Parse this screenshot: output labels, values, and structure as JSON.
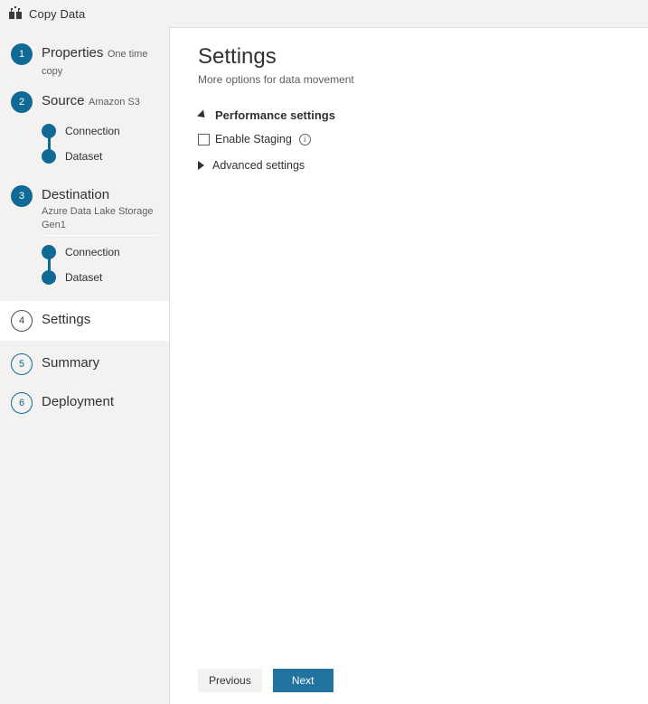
{
  "header": {
    "title": "Copy Data",
    "icon": "copy-data-icon"
  },
  "sidebar": {
    "steps": [
      {
        "number": "1",
        "label": "Properties",
        "sublabel": "One time copy",
        "state": "completed",
        "substeps": []
      },
      {
        "number": "2",
        "label": "Source",
        "sublabel": "Amazon S3",
        "state": "completed",
        "substeps": [
          {
            "label": "Connection"
          },
          {
            "label": "Dataset"
          }
        ]
      },
      {
        "number": "3",
        "label": "Destination",
        "sublabel": "Azure Data Lake Storage Gen1",
        "state": "completed",
        "substeps": [
          {
            "label": "Connection"
          },
          {
            "label": "Dataset"
          }
        ]
      },
      {
        "number": "4",
        "label": "Settings",
        "sublabel": "",
        "state": "active",
        "substeps": []
      },
      {
        "number": "5",
        "label": "Summary",
        "sublabel": "",
        "state": "upcoming",
        "substeps": []
      },
      {
        "number": "6",
        "label": "Deployment",
        "sublabel": "",
        "state": "upcoming",
        "substeps": []
      }
    ]
  },
  "main": {
    "title": "Settings",
    "subtitle": "More options for data movement",
    "performance_section": {
      "title": "Performance settings",
      "expanded": true,
      "toggle_icon": "triangle-expanded-icon",
      "checkbox": {
        "label": "Enable Staging",
        "checked": false,
        "info_icon": "info-icon",
        "info_glyph": "i"
      }
    },
    "advanced_section": {
      "title": "Advanced settings",
      "expanded": false,
      "toggle_icon": "triangle-collapsed-icon"
    }
  },
  "footer": {
    "previous_label": "Previous",
    "next_label": "Next"
  },
  "colors": {
    "accent_teal": "#0f6a95",
    "primary_button": "#2273a0",
    "sidebar_bg": "#f3f2f1",
    "content_bg": "#ffffff",
    "text_primary": "#323130",
    "text_secondary": "#605e5c"
  }
}
